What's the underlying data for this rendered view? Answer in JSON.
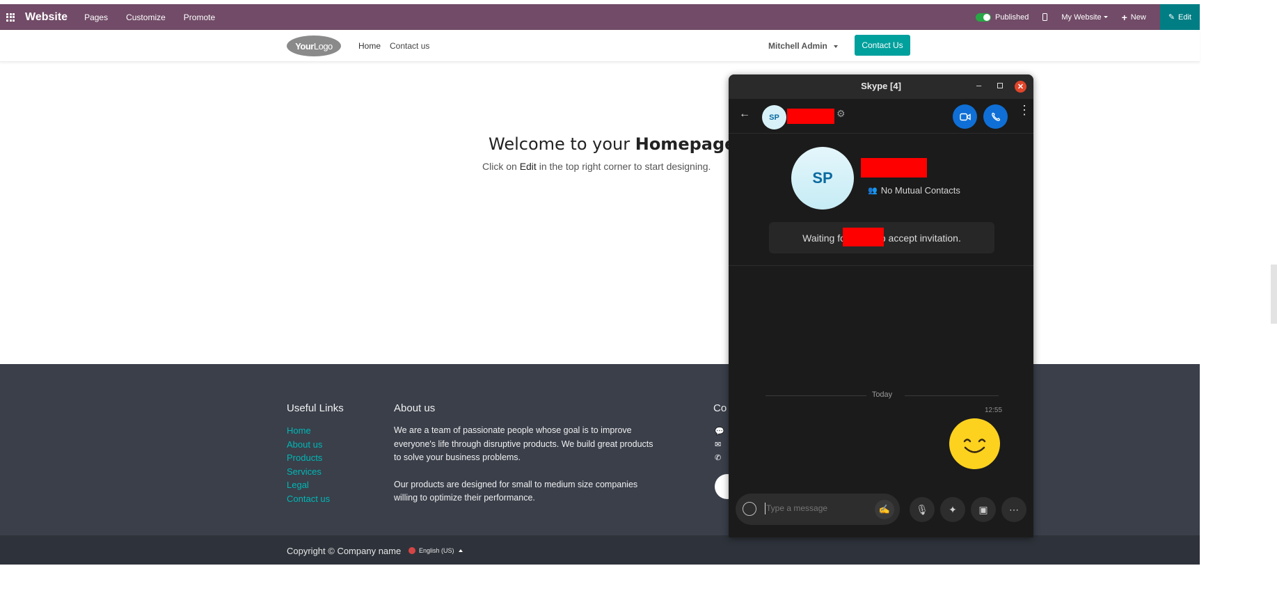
{
  "topbar": {
    "brand": "Website",
    "nav": [
      "Pages",
      "Customize",
      "Promote"
    ],
    "published_label": "Published",
    "my_website_label": "My Website",
    "new_label": "New",
    "edit_label": "Edit",
    "bar_color": "#714b67",
    "edit_color": "#017e84"
  },
  "site_header": {
    "logo_text_bold": "Your",
    "logo_text_light": "Logo",
    "nav": [
      "Home",
      "Contact us"
    ],
    "user_name": "Mitchell Admin",
    "contact_button": "Contact Us",
    "accent_color": "#00a09d"
  },
  "hero": {
    "title_prefix": "Welcome to your ",
    "title_bold": "Homepage",
    "title_suffix": "!",
    "subtitle_prefix": "Click on ",
    "subtitle_em": "Edit",
    "subtitle_suffix": " in the top right corner to start designing."
  },
  "footer": {
    "useful_links_title": "Useful Links",
    "links": [
      "Home",
      "About us",
      "Products",
      "Services",
      "Legal",
      "Contact us"
    ],
    "about_title": "About us",
    "about_p1": "We are a team of passionate people whose goal is to improve everyone's life through disruptive products. We build great products to solve your business problems.",
    "about_p2": "Our products are designed for small to medium size companies willing to optimize their performance.",
    "contact_title_partial": "Co",
    "copyright": "Copyright © Company name",
    "language": "English (US)",
    "link_color": "#00b7b5"
  },
  "skype": {
    "window_title": "Skype [4]",
    "avatar_initials": "SP",
    "mutual_contacts": "No Mutual Contacts",
    "invite_prefix": "Waiting fo",
    "invite_suffix": "o accept invitation.",
    "today_label": "Today",
    "message_time": "12:55",
    "input_placeholder": "Type a message",
    "call_button_color": "#0f6fd6",
    "emoji_color": "#fcd21f",
    "redaction_color": "#ff0000"
  }
}
